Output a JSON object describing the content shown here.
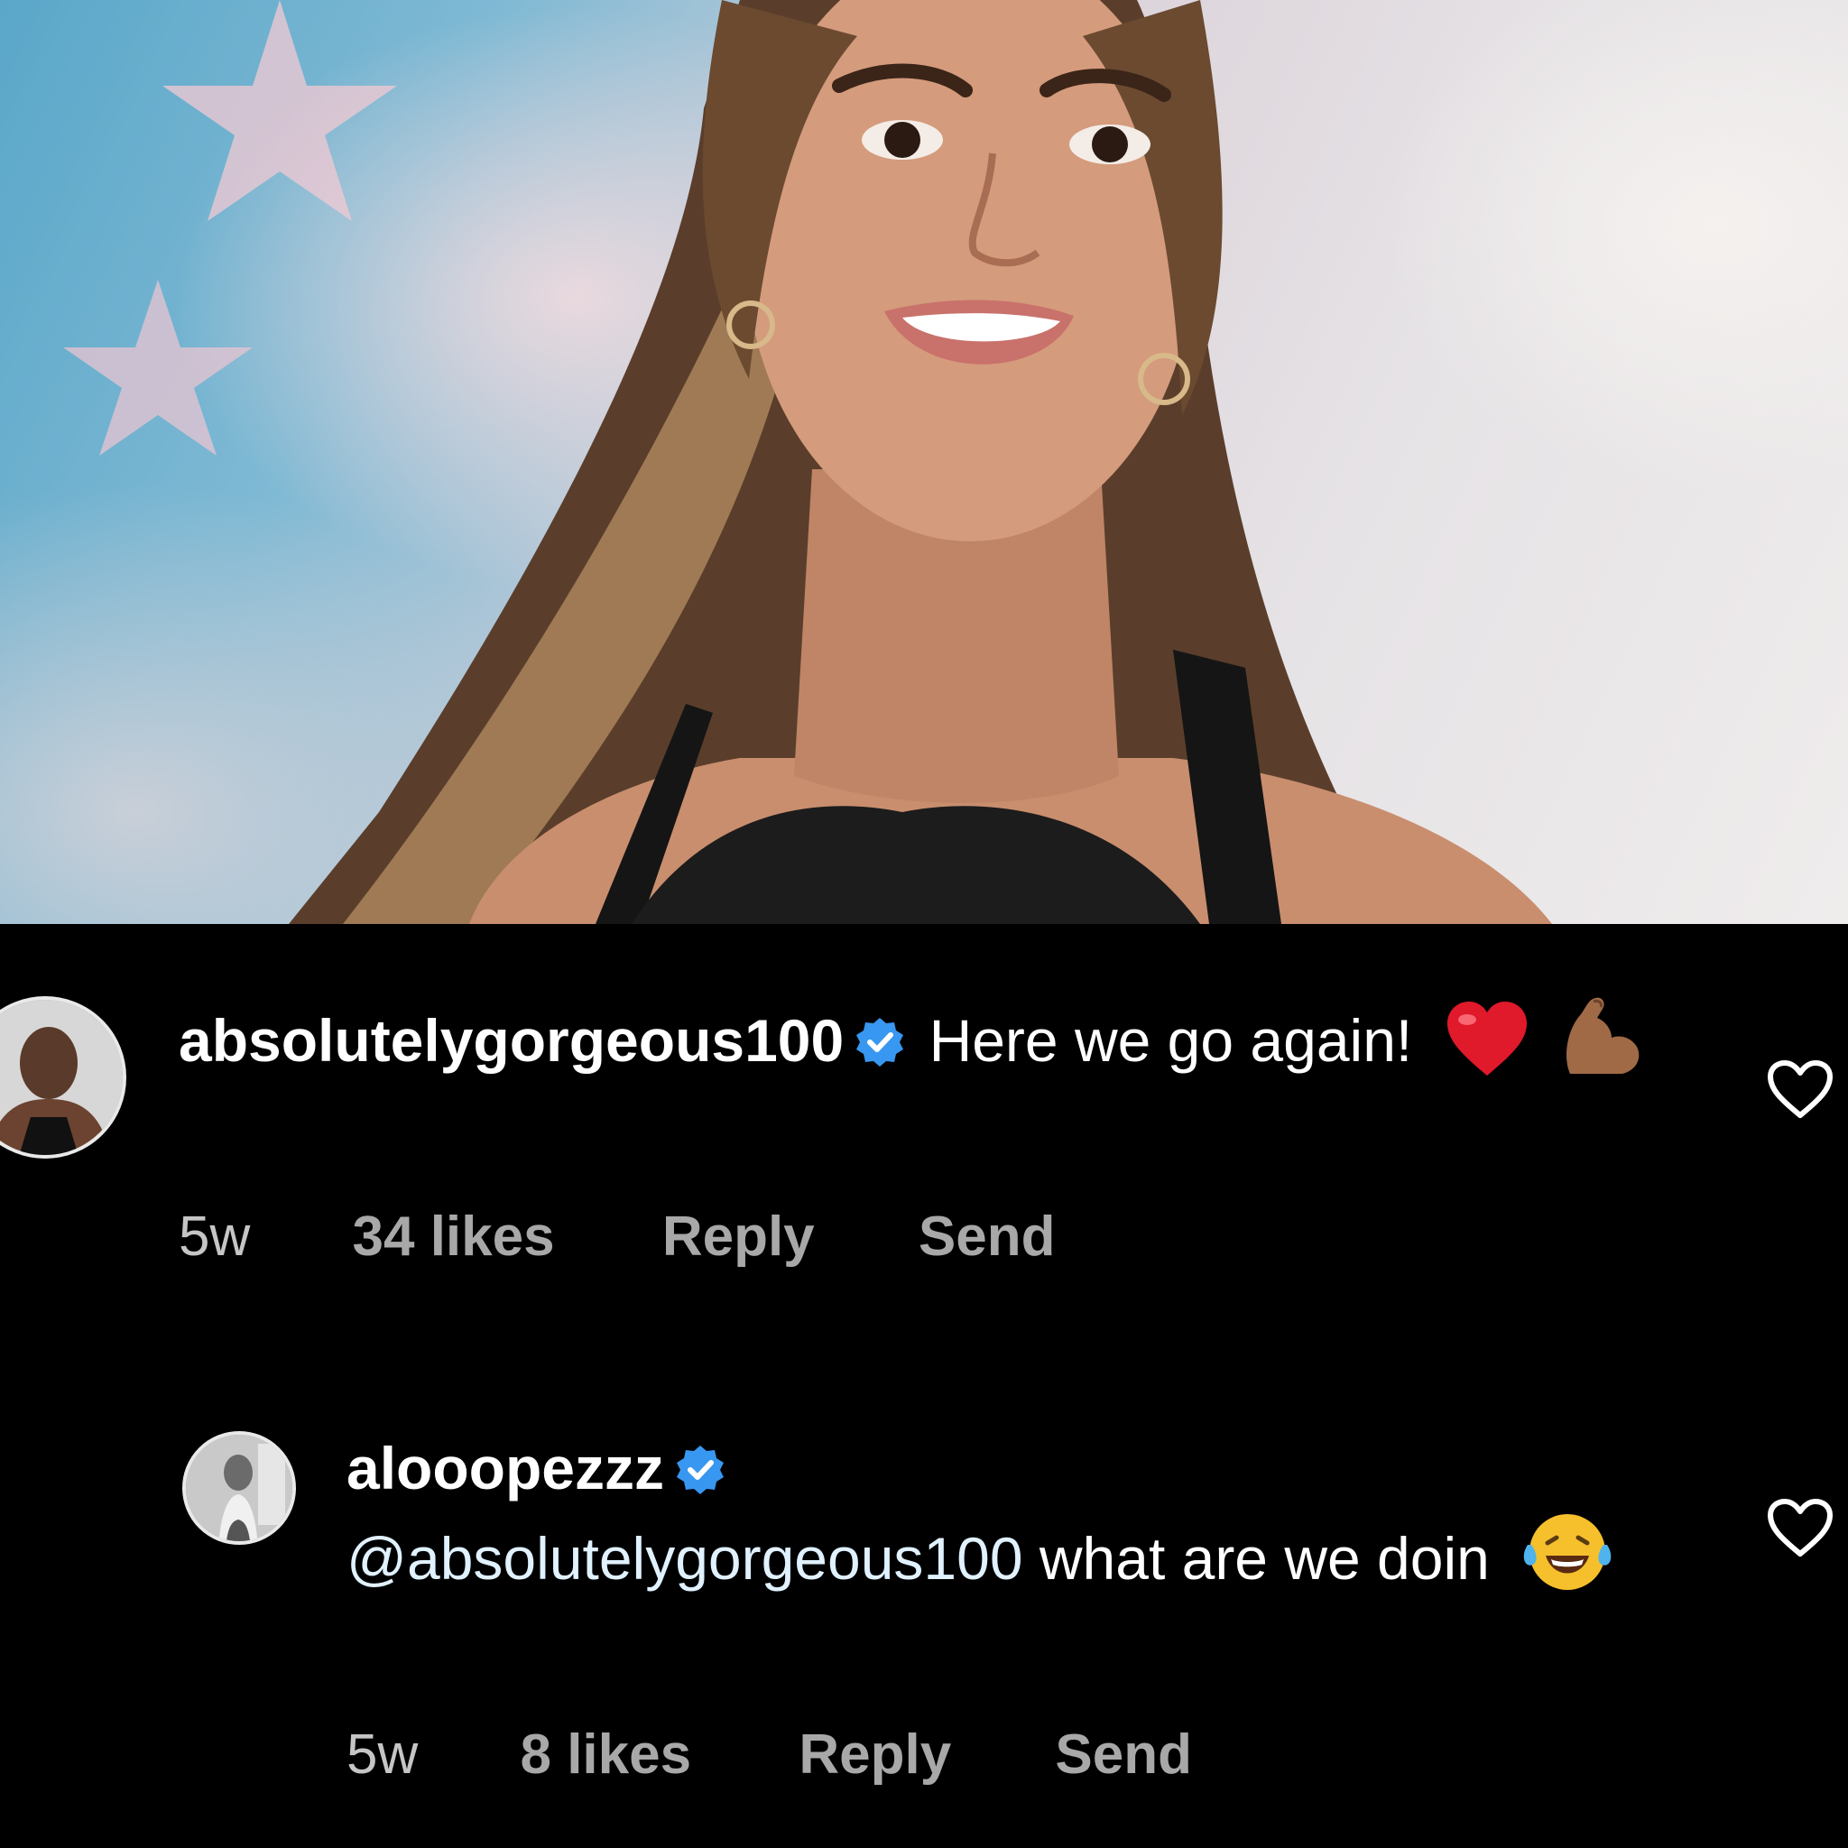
{
  "post": {
    "image_alt": "Portrait of smiling woman with long hair in a black tank top against a pastel sky with stars"
  },
  "comments": [
    {
      "username": "absolutelygorgeous100",
      "verified": true,
      "text": "Here we go again!",
      "emojis": [
        "red-heart-emoji",
        "flexed-biceps-emoji"
      ],
      "age": "5w",
      "likes": "34 likes",
      "reply_label": "Reply",
      "send_label": "Send"
    },
    {
      "username": "alooopezzz",
      "verified": true,
      "mention": "@absolutelygorgeous100",
      "text": "what are we doin",
      "emojis": [
        "face-with-tears-of-joy-emoji"
      ],
      "age": "5w",
      "likes": "8 likes",
      "reply_label": "Reply",
      "send_label": "Send"
    }
  ],
  "colors": {
    "background": "#000000",
    "text": "#ffffff",
    "meta": "#a8a8a8",
    "verified_badge": "#3897f0",
    "mention": "#e0f1ff"
  }
}
